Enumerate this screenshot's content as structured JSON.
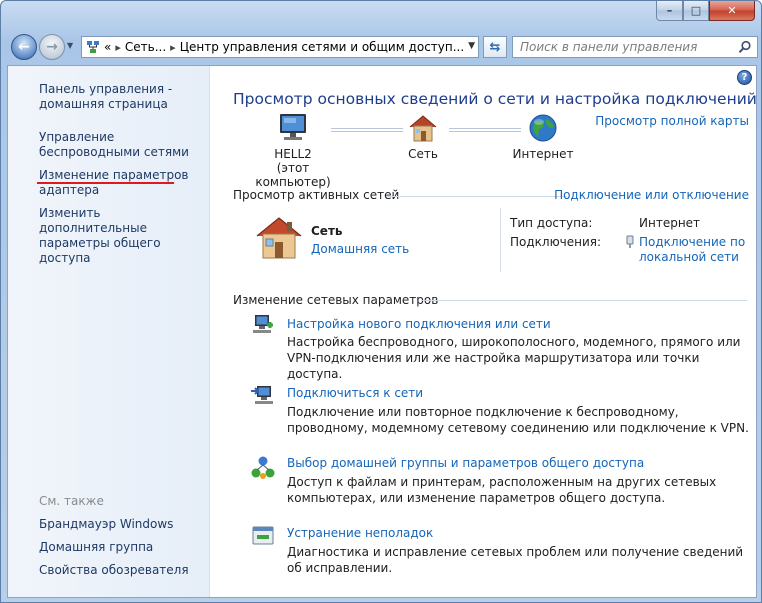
{
  "window": {
    "controls": {
      "minimize": "–",
      "maximize": "□",
      "close": "✕"
    }
  },
  "navbar": {
    "back_icon": "back-arrow-icon",
    "forward_icon": "forward-arrow-icon",
    "address": {
      "overflow": "«",
      "crumb1": "Сеть...",
      "sep": "▸",
      "crumb2": "Центр управления сетями и общим доступ..."
    },
    "search_placeholder": "Поиск в панели управления"
  },
  "sidebar": {
    "items": [
      {
        "label": "Панель управления - домашняя страница"
      },
      {
        "label": "Управление беспроводными сетями"
      },
      {
        "label": "Изменение параметров адаптера"
      },
      {
        "label": "Изменить дополнительные параметры общего доступа"
      }
    ],
    "see_also_header": "См. также",
    "see_also": [
      {
        "label": "Брандмауэр Windows"
      },
      {
        "label": "Домашняя группа"
      },
      {
        "label": "Свойства обозревателя"
      }
    ],
    "highlight_color": "#e0181f"
  },
  "main": {
    "help": "?",
    "title": "Просмотр основных сведений о сети и настройка подключений",
    "full_map_link": "Просмотр полной карты",
    "map": {
      "computer": {
        "name": "HELL2",
        "sub": "(этот компьютер)"
      },
      "network": {
        "name": "Сеть"
      },
      "internet": {
        "name": "Интернет"
      }
    },
    "active_header": "Просмотр активных сетей",
    "connect_link": "Подключение или отключение",
    "active_network": {
      "name": "Сеть",
      "type": "Домашняя сеть",
      "access_label": "Тип доступа:",
      "access_value": "Интернет",
      "conn_label": "Подключения:",
      "conn_value_line1": "Подключение по",
      "conn_value_line2": "локальной сети"
    },
    "change_header": "Изменение сетевых параметров",
    "tasks": [
      {
        "title": "Настройка нового подключения или сети",
        "desc": "Настройка беспроводного, широкополосного, модемного, прямого или VPN-подключения или же настройка маршрутизатора или точки доступа."
      },
      {
        "title": "Подключиться к сети",
        "desc": "Подключение или повторное подключение к беспроводному, проводному, модемному сетевому соединению или подключение к VPN."
      },
      {
        "title": "Выбор домашней группы и параметров общего доступа",
        "desc": "Доступ к файлам и принтерам, расположенным на других сетевых компьютерах, или изменение параметров общего доступа."
      },
      {
        "title": "Устранение неполадок",
        "desc": "Диагностика и исправление сетевых проблем или получение сведений об исправлении."
      }
    ]
  }
}
